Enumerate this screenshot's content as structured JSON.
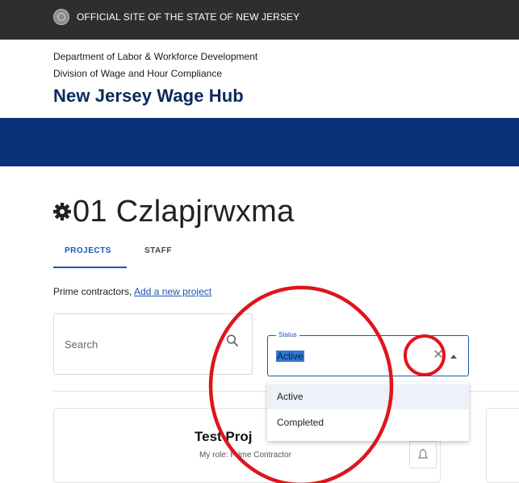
{
  "banner": {
    "text": "OFFICIAL SITE OF THE STATE OF NEW JERSEY",
    "seal_icon": "state-seal-icon"
  },
  "header": {
    "department": "Department of Labor & Workforce Development",
    "division": "Division of Wage and Hour Compliance",
    "app_title": "New Jersey Wage Hub"
  },
  "page": {
    "title": "01 Czlapjrwxma",
    "title_icon": "gear-icon",
    "tabs": [
      {
        "label": "PROJECTS",
        "selected": true
      },
      {
        "label": "STAFF",
        "selected": false
      }
    ],
    "prime_text": "Prime contractors, ",
    "add_project_link": "Add a new project"
  },
  "filters": {
    "search_placeholder": "Search",
    "status_label": "Status",
    "status_value": "Active",
    "status_options": [
      "Active",
      "Completed"
    ]
  },
  "card": {
    "title": "Test Proj",
    "role": "My role: Prime Contractor"
  },
  "colors": {
    "banner_bg": "#2e2e2e",
    "brand_blue": "#08337b",
    "accent": "#1a57b0",
    "annotation_red": "#e0141c"
  }
}
